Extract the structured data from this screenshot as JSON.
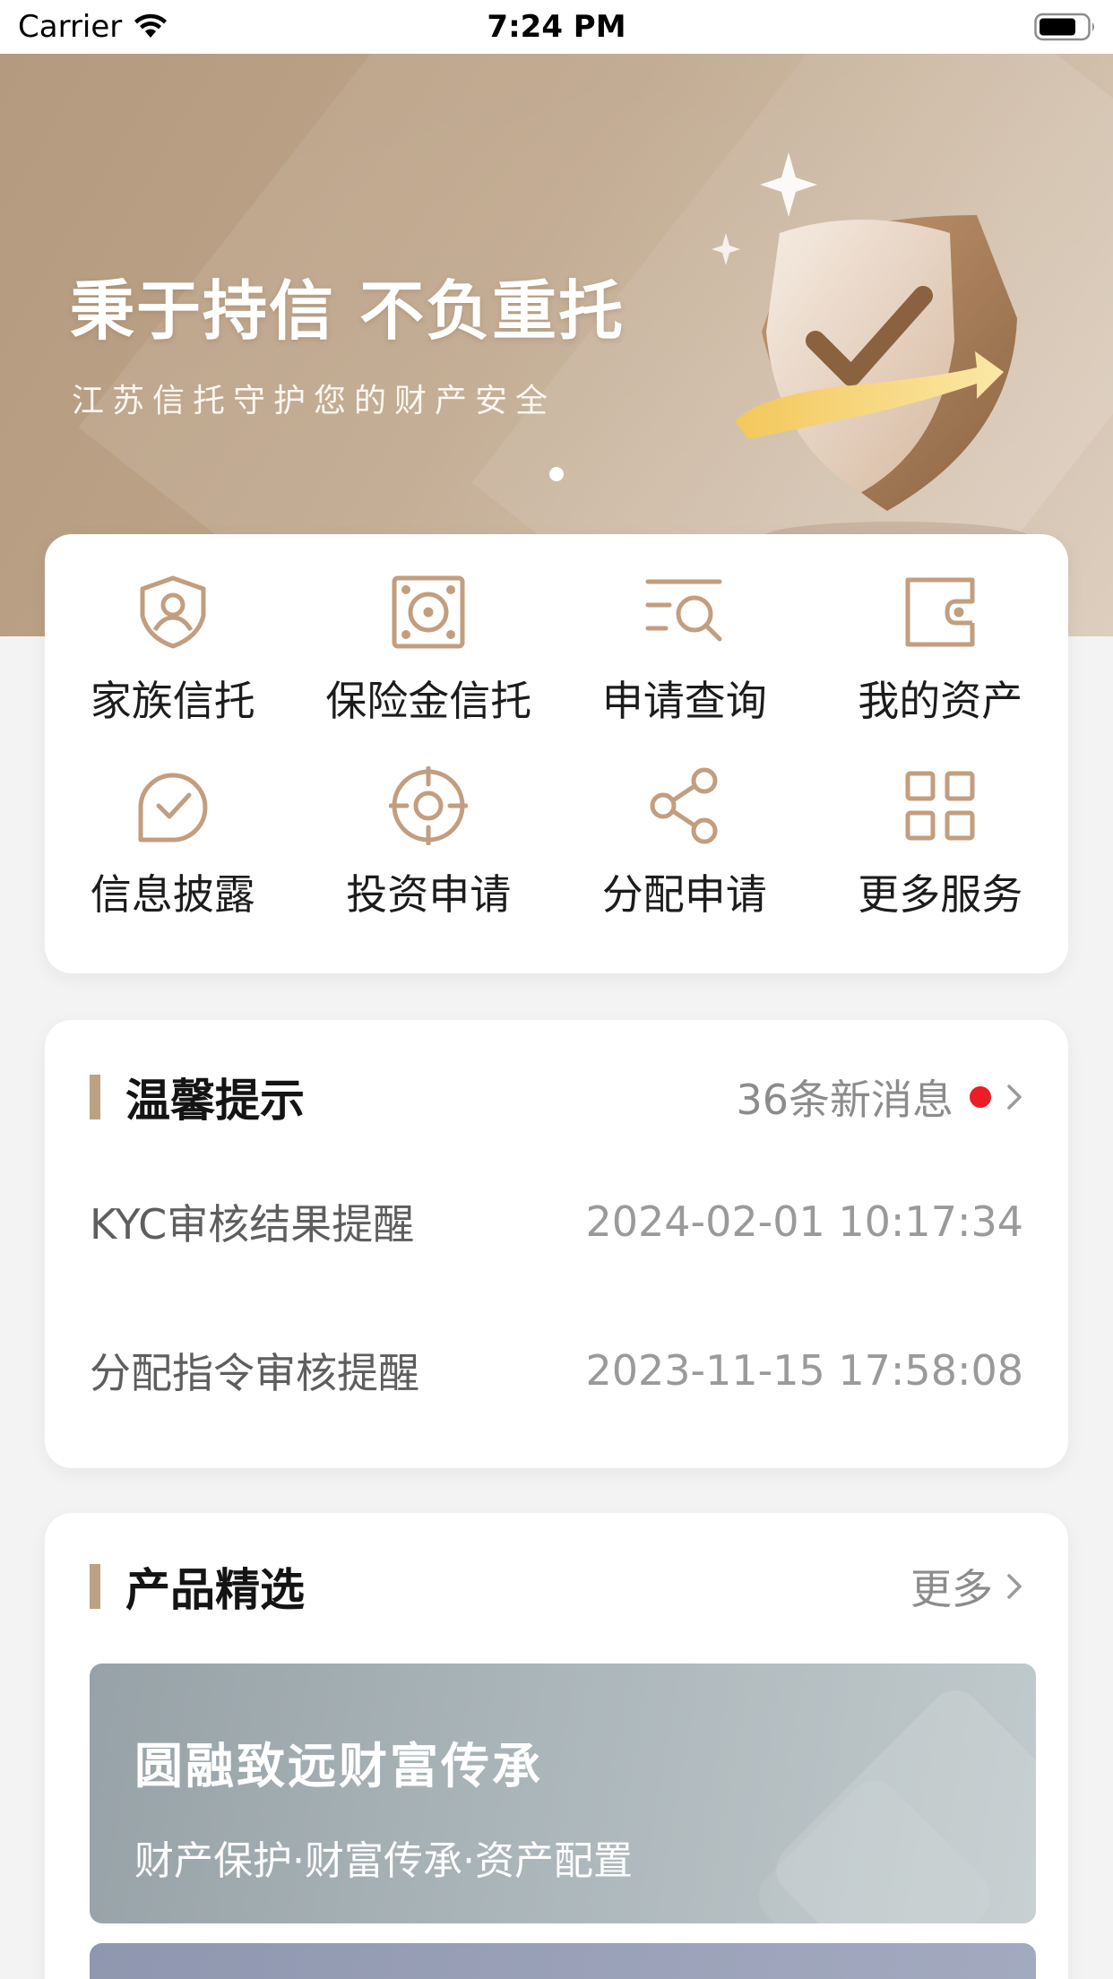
{
  "status_bar": {
    "carrier": "Carrier",
    "time": "7:24 PM"
  },
  "banner": {
    "title": "秉于持信 不负重托",
    "subtitle": "江苏信托守护您的财产安全"
  },
  "services": [
    {
      "label": "家族信托",
      "icon": "shield-person-icon"
    },
    {
      "label": "保险金信托",
      "icon": "safe-icon"
    },
    {
      "label": "申请查询",
      "icon": "search-list-icon"
    },
    {
      "label": "我的资产",
      "icon": "wallet-icon"
    },
    {
      "label": "信息披露",
      "icon": "check-circle-icon"
    },
    {
      "label": "投资申请",
      "icon": "target-icon"
    },
    {
      "label": "分配申请",
      "icon": "share-icon"
    },
    {
      "label": "更多服务",
      "icon": "grid-icon"
    }
  ],
  "tips": {
    "title": "温馨提示",
    "badge_text": "36条新消息",
    "items": [
      {
        "name": "KYC审核结果提醒",
        "time": "2024-02-01 10:17:34"
      },
      {
        "name": "分配指令审核提醒",
        "time": "2023-11-15 17:58:08"
      }
    ]
  },
  "products": {
    "title": "产品精选",
    "more_label": "更多",
    "items": [
      {
        "title": "圆融致远财富传承",
        "subtitle": "财产保护·财富传承·资产配置"
      }
    ]
  },
  "colors": {
    "accent": "#bca183",
    "icon": "#c29e7f",
    "badge": "#ee1c25"
  }
}
